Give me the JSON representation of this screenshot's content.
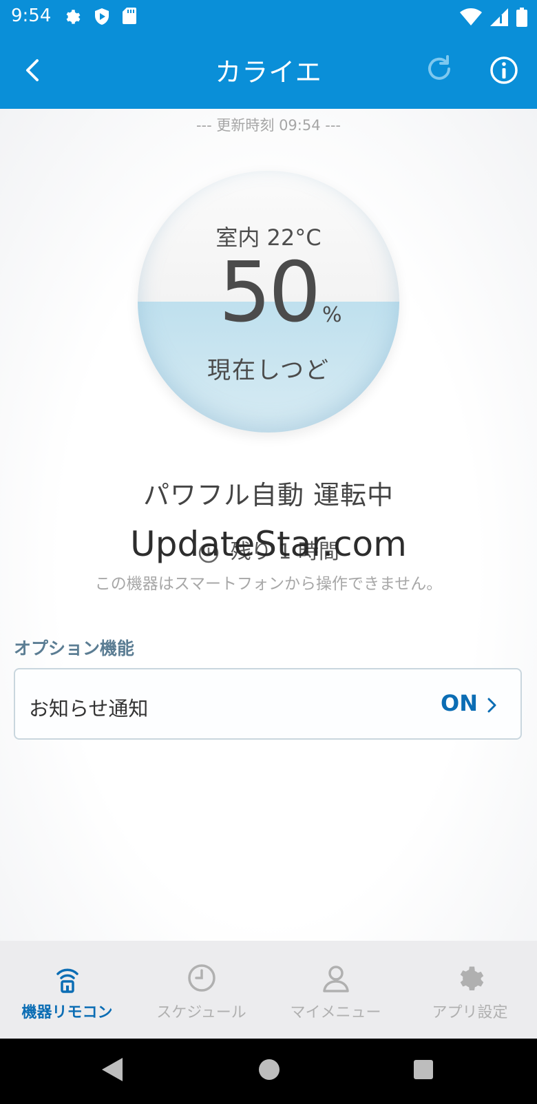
{
  "status_bar": {
    "time": "9:54"
  },
  "app_bar": {
    "title": "カライエ"
  },
  "updated": "--- 更新時刻 09:54 ---",
  "humidity": {
    "room_temp": "室内 22°C",
    "value": "50",
    "unit": "%",
    "label": "現在しつど",
    "fill_fraction": 0.5
  },
  "mode": "パワフル自動 運転中",
  "timer_text": "残り 1 時間",
  "watermark": "UpdateStar.com",
  "notice": "この機器はスマートフォンから操作できません。",
  "options": {
    "section_title": "オプション機能",
    "items": [
      {
        "label": "お知らせ通知",
        "value": "ON"
      }
    ]
  },
  "bottom_nav": {
    "items": [
      {
        "label": "機器リモコン",
        "icon": "remote-icon",
        "active": true
      },
      {
        "label": "スケジュール",
        "icon": "clock-icon",
        "active": false
      },
      {
        "label": "マイメニュー",
        "icon": "person-icon",
        "active": false
      },
      {
        "label": "アプリ設定",
        "icon": "gear-icon",
        "active": false
      }
    ]
  },
  "colors": {
    "primary": "#0a8fd8",
    "accent": "#0b6db4",
    "water": "#bfe0ee"
  }
}
